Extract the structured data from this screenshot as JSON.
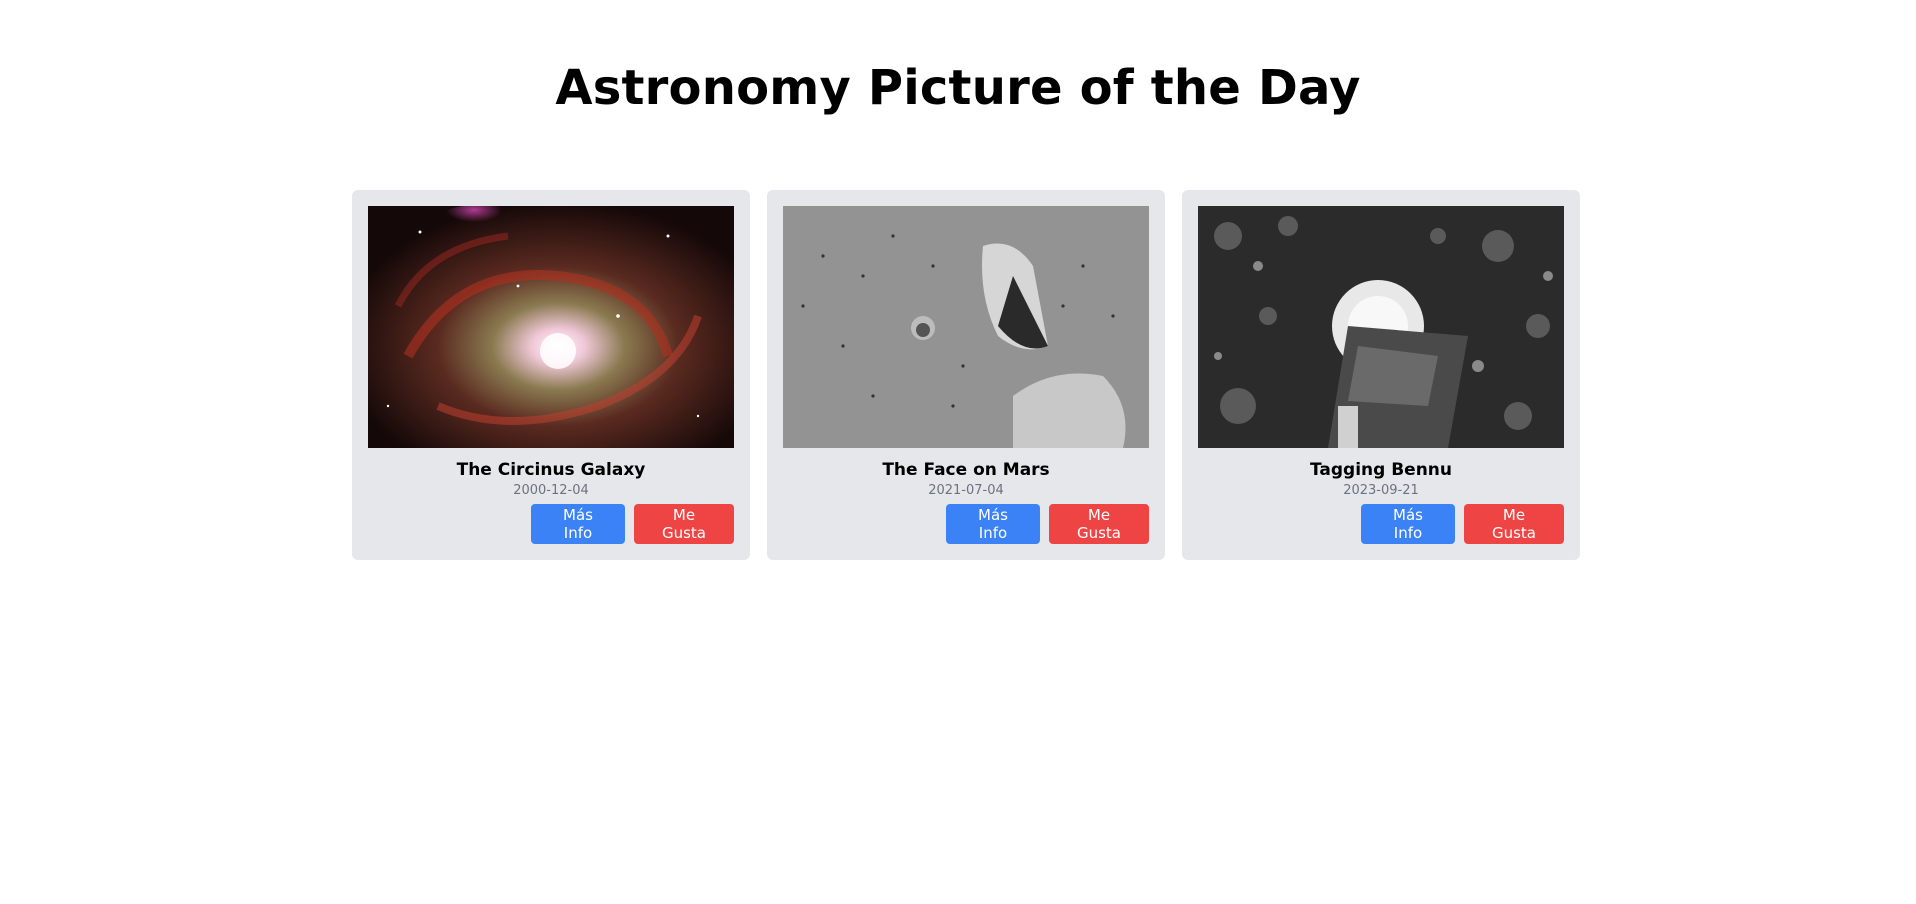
{
  "header": {
    "title": "Astronomy Picture of the Day"
  },
  "cards": [
    {
      "title": "The Circinus Galaxy",
      "date": "2000-12-04",
      "image_icon": "galaxy-image",
      "info_label": "Más Info",
      "like_label": "Me Gusta"
    },
    {
      "title": "The Face on Mars",
      "date": "2021-07-04",
      "image_icon": "mars-face-image",
      "info_label": "Más Info",
      "like_label": "Me Gusta"
    },
    {
      "title": "Tagging Bennu",
      "date": "2023-09-21",
      "image_icon": "bennu-sample-image",
      "info_label": "Más Info",
      "like_label": "Me Gusta"
    }
  ],
  "colors": {
    "card_bg": "#e5e7eb",
    "info_button": "#3b82f6",
    "like_button": "#ef4444",
    "date_text": "#6b7280"
  }
}
